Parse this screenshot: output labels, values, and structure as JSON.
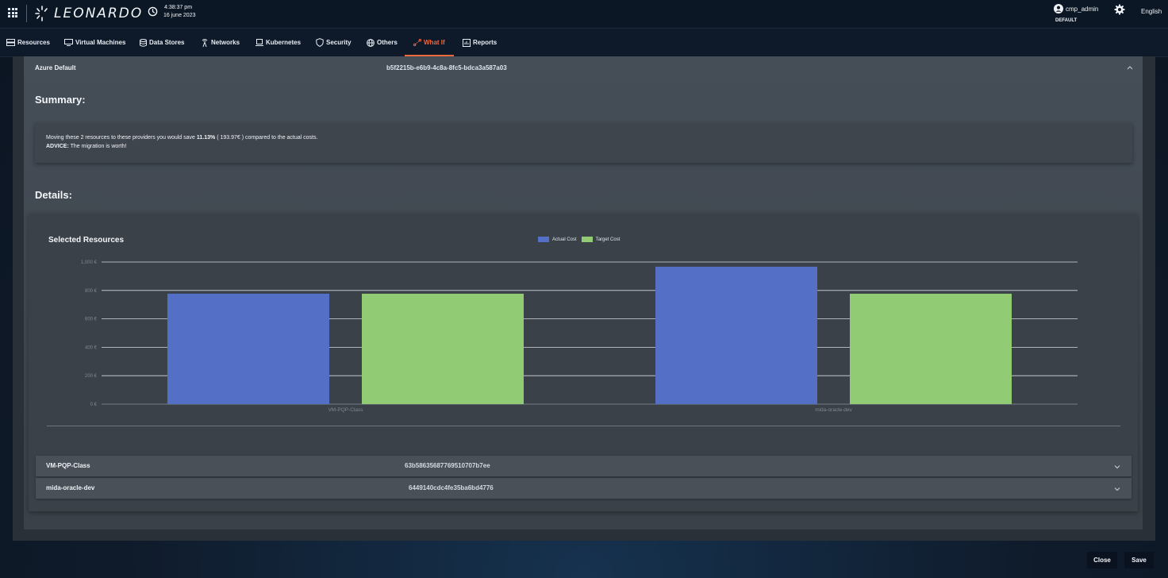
{
  "header": {
    "brand": "LEONARDO",
    "time": "4:38:37 pm",
    "date": "16 june 2023",
    "username": "cmp_admin",
    "tenant": "DEFAULT",
    "language": "English"
  },
  "nav": {
    "items": [
      {
        "label": "Resources",
        "icon": "server-icon"
      },
      {
        "label": "Virtual Machines",
        "icon": "monitor-icon"
      },
      {
        "label": "Data Stores",
        "icon": "database-icon"
      },
      {
        "label": "Networks",
        "icon": "antenna-icon"
      },
      {
        "label": "Kubernetes",
        "icon": "laptop-icon"
      },
      {
        "label": "Security",
        "icon": "shield-icon"
      },
      {
        "label": "Others",
        "icon": "globe-icon"
      },
      {
        "label": "What If",
        "icon": "route-icon",
        "active": true
      },
      {
        "label": "Reports",
        "icon": "report-icon"
      }
    ]
  },
  "provider": {
    "name": "Azure Default",
    "id": "b5f2215b-e6b9-4c8a-8fc5-bdca3a587a03"
  },
  "summary": {
    "heading": "Summary:",
    "line1_prefix": "Moving these 2 resources to these providers you would save ",
    "percent": "11.13%",
    "line1_mid": " ( 193.97€ ) compared to the actual costs.",
    "advice_label": "ADVICE:",
    "advice_text": " The migration is worth!"
  },
  "details": {
    "heading": "Details:"
  },
  "chart_data": {
    "type": "bar",
    "title": "Selected Resources",
    "categories": [
      "VM-PQP-Class",
      "mida-oracle-dev"
    ],
    "series": [
      {
        "name": "Actual Cost",
        "values": [
          777,
          967
        ],
        "color": "#5470c6"
      },
      {
        "name": "Target Cost",
        "values": [
          777,
          777
        ],
        "color": "#91cc75"
      }
    ],
    "yticks": [
      "0 €",
      "200 €",
      "400 €",
      "600 €",
      "800 €",
      "1,000 €"
    ],
    "ylim": [
      0,
      1000
    ],
    "legend": "top-center",
    "grid": true
  },
  "resources": [
    {
      "name": "VM-PQP-Class",
      "id": "63b58635687769510707b7ee"
    },
    {
      "name": "mida-oracle-dev",
      "id": "6449140cdc4fe35ba6bd4776"
    }
  ],
  "footer": {
    "close_label": "Close",
    "save_label": "Save"
  }
}
